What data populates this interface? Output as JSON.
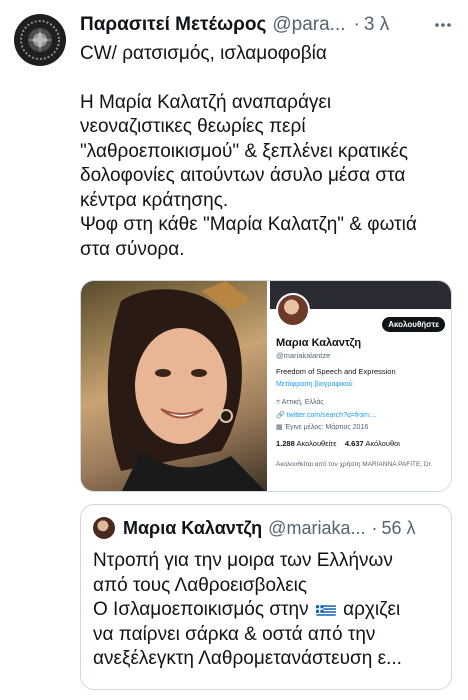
{
  "tweet": {
    "author_name": "Παρασιτεί Μετέωρος",
    "author_handle": "@para...",
    "separator": "·",
    "time": "3 λ",
    "lines": [
      "CW/ ρατσισμός, ισλαμοφοβία",
      "Η Μαρία Καλατζή αναπαράγει",
      "νεοναζιστικες θεωρίες περί",
      "\"λαθροεποικισμού\" & ξεπλένει κρατικές",
      "δολοφονίες αιτούντων άσυλο μέσα στα",
      "κέντρα κράτησης.",
      "Ψοφ στη κάθε \"Μαρία Καλατζη\" & φωτιά",
      "στα σύνορα."
    ],
    "icons": {
      "avatar": "seal-avatar-icon",
      "more": "more-options-icon"
    }
  },
  "media_profile": {
    "follow_label": "Ακολουθήστε",
    "name": "Μαρια Καλαντζη",
    "handle": "@mariakalantze",
    "bio": "Freedom of Speech and Expression",
    "translate": "Μετάφραση βιογραφικού",
    "location": "Αττική, Ελλάς",
    "link": "twitter.com/search?q=from:...",
    "joined": "Έγινε μέλος: Μάρτιος 2016",
    "following_count": "1.288",
    "following_label": "Ακολουθείτε",
    "followers_count": "4.637",
    "followers_label": "Ακόλουθοι",
    "followed_by": "Ακολουθείται από τον χρήστη MARIANNA PAFITE, Dr."
  },
  "quote": {
    "author_name": "Μαρια Καλαντζη",
    "author_handle": "@mariaka...",
    "separator": "·",
    "time": "56 λ",
    "line1": "Ντροπή για την μοιρα των Ελλήνων",
    "line2": "από τους Λαθροεισβολεις",
    "line3_before": "Ο Ισλαμοεποικισμός στην",
    "line3_after": "αρχιζει",
    "line4": "να παίρνει σάρκα & οστά από την",
    "line5": "ανεξέλεγκτη Λαθρομετανάστευση ε...",
    "flag_icon": "greek-flag-icon"
  },
  "colors": {
    "text": "#0f1419",
    "secondary": "#536471",
    "link": "#1d9bf0",
    "border": "#cfd9de"
  }
}
